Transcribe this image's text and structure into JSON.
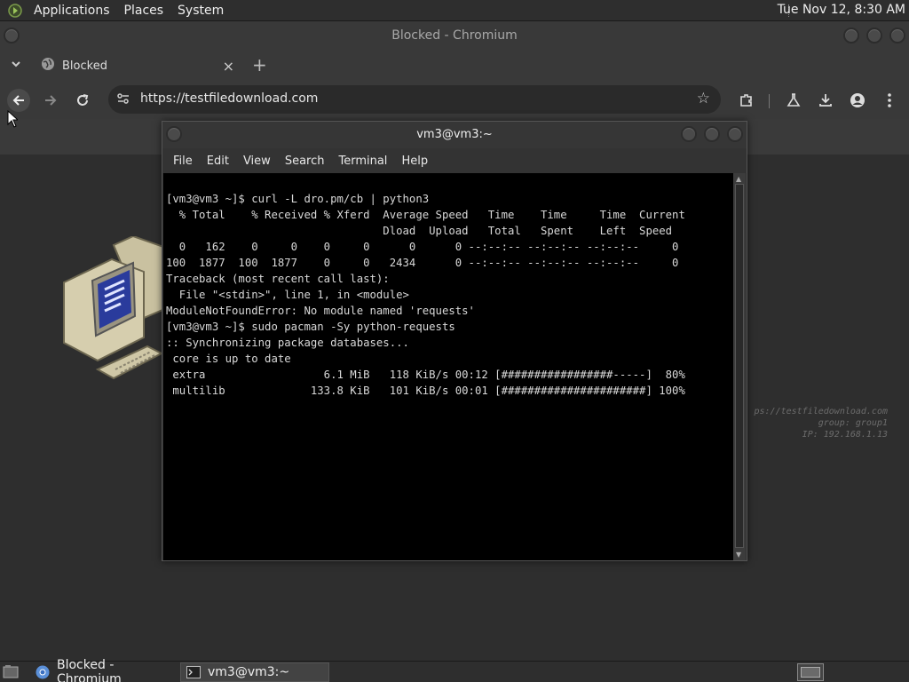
{
  "top_panel": {
    "menus": [
      "Applications",
      "Places",
      "System"
    ],
    "clock": "Tue Nov 12,  8:30 AM"
  },
  "chromium": {
    "window_title": "Blocked - Chromium",
    "tab_title": "Blocked",
    "tab_close": "×",
    "new_tab": "+",
    "url": "https://testfiledownload.com",
    "page_info": [
      "ps://testfiledownload.com",
      "group: group1",
      "IP: 192.168.1.13"
    ]
  },
  "terminal": {
    "window_title": "vm3@vm3:~",
    "menu": [
      "File",
      "Edit",
      "View",
      "Search",
      "Terminal",
      "Help"
    ],
    "lines": [
      "[vm3@vm3 ~]$ curl -L dro.pm/cb | python3",
      "  % Total    % Received % Xferd  Average Speed   Time    Time     Time  Current",
      "                                 Dload  Upload   Total   Spent    Left  Speed",
      "  0   162    0     0    0     0      0      0 --:--:-- --:--:-- --:--:--     0",
      "100  1877  100  1877    0     0   2434      0 --:--:-- --:--:-- --:--:--     0",
      "Traceback (most recent call last):",
      "  File \"<stdin>\", line 1, in <module>",
      "ModuleNotFoundError: No module named 'requests'",
      "[vm3@vm3 ~]$ sudo pacman -Sy python-requests",
      ":: Synchronizing package databases...",
      " core is up to date",
      " extra                  6.1 MiB   118 KiB/s 00:12 [#################-----]  80%",
      " multilib             133.8 KiB   101 KiB/s 00:01 [######################] 100%"
    ]
  },
  "taskbar": {
    "items": [
      "Blocked - Chromium",
      "vm3@vm3:~"
    ]
  },
  "colors": {
    "panel_bg": "#2e2e2e",
    "terminal_bg": "#000000",
    "terminal_fg": "#d8d8d8"
  },
  "icons": [
    "app-menu-icon",
    "globe-icon",
    "chevron-down-icon",
    "back-icon",
    "forward-icon",
    "reload-icon",
    "site-settings-icon",
    "star-icon",
    "extensions-icon",
    "labs-icon",
    "download-icon",
    "profile-icon",
    "more-icon",
    "computer-illustration-icon",
    "show-desktop-icon",
    "chromium-icon",
    "terminal-icon"
  ]
}
